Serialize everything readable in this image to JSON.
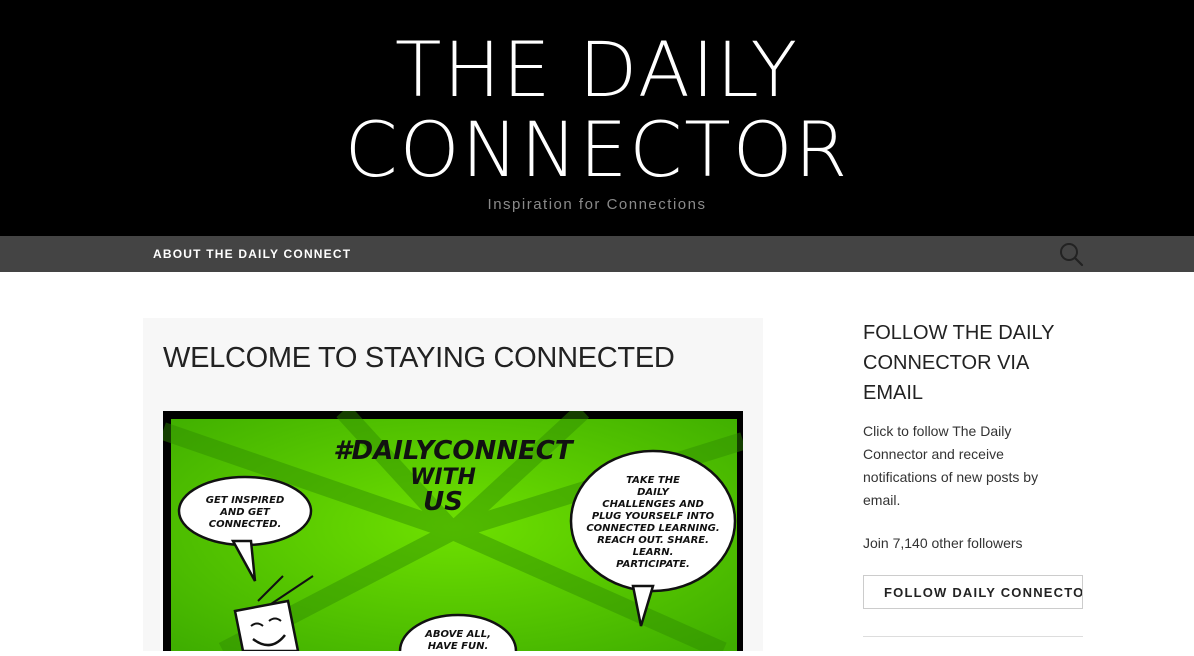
{
  "site": {
    "title_line1": "THE DAILY",
    "title_line2": "CONNECTOR",
    "tagline": "Inspiration for Connections"
  },
  "nav": {
    "items": [
      {
        "label": "ABOUT THE DAILY CONNECT"
      }
    ],
    "search_icon": "search-icon"
  },
  "post": {
    "title": "WELCOME TO STAYING CONNECTED",
    "image": {
      "headline_line1": "#DAILYCONNECT",
      "headline_line2": "WITH",
      "headline_line3": "US",
      "bubble_left": [
        "GET INSPIRED",
        "AND GET",
        "CONNECTED."
      ],
      "bubble_right": [
        "TAKE THE",
        "DAILY",
        "CHALLENGES AND",
        "PLUG YOURSELF INTO",
        "CONNECTED LEARNING.",
        "REACH OUT. SHARE.",
        "LEARN.",
        "PARTICIPATE."
      ],
      "bubble_bottom": [
        "ABOVE ALL,",
        "HAVE FUN."
      ]
    }
  },
  "sidebar": {
    "widget_title": "FOLLOW THE DAILY CONNECTOR VIA EMAIL",
    "description": "Click to follow The Daily Connector and receive notifications of new posts by email.",
    "followers": "Join 7,140 other followers",
    "follow_button": "FOLLOW DAILY CONNECTOR"
  },
  "colors": {
    "header_bg": "#000000",
    "nav_bg": "#444444",
    "comic_green": "#5cd400"
  }
}
